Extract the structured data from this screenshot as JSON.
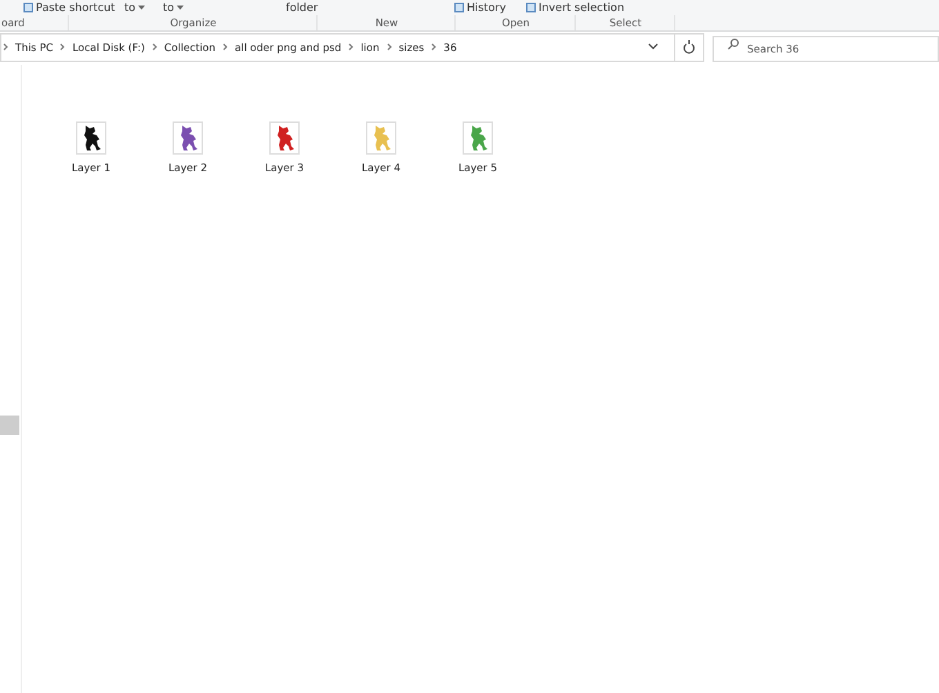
{
  "ribbon": {
    "commands": [
      {
        "label": "Paste shortcut",
        "kind": "icon"
      },
      {
        "label": "to",
        "kind": "dropdown"
      },
      {
        "label": "to",
        "kind": "dropdown"
      },
      {
        "label": "folder",
        "kind": "plain"
      },
      {
        "label": "History",
        "kind": "icon"
      },
      {
        "label": "Invert selection",
        "kind": "icon"
      }
    ],
    "groups": [
      "oard",
      "Organize",
      "New",
      "Open",
      "Select"
    ]
  },
  "address": {
    "crumbs": [
      "This PC",
      "Local Disk (F:)",
      "Collection",
      "all oder png and psd",
      "lion",
      "sizes",
      "36"
    ]
  },
  "search": {
    "placeholder": "Search 36"
  },
  "files": [
    {
      "name": "Layer 1",
      "color": "#111111"
    },
    {
      "name": "Layer 2",
      "color": "#7b4fb0"
    },
    {
      "name": "Layer 3",
      "color": "#d02020"
    },
    {
      "name": "Layer 4",
      "color": "#e8c050"
    },
    {
      "name": "Layer 5",
      "color": "#4aa64a"
    }
  ]
}
